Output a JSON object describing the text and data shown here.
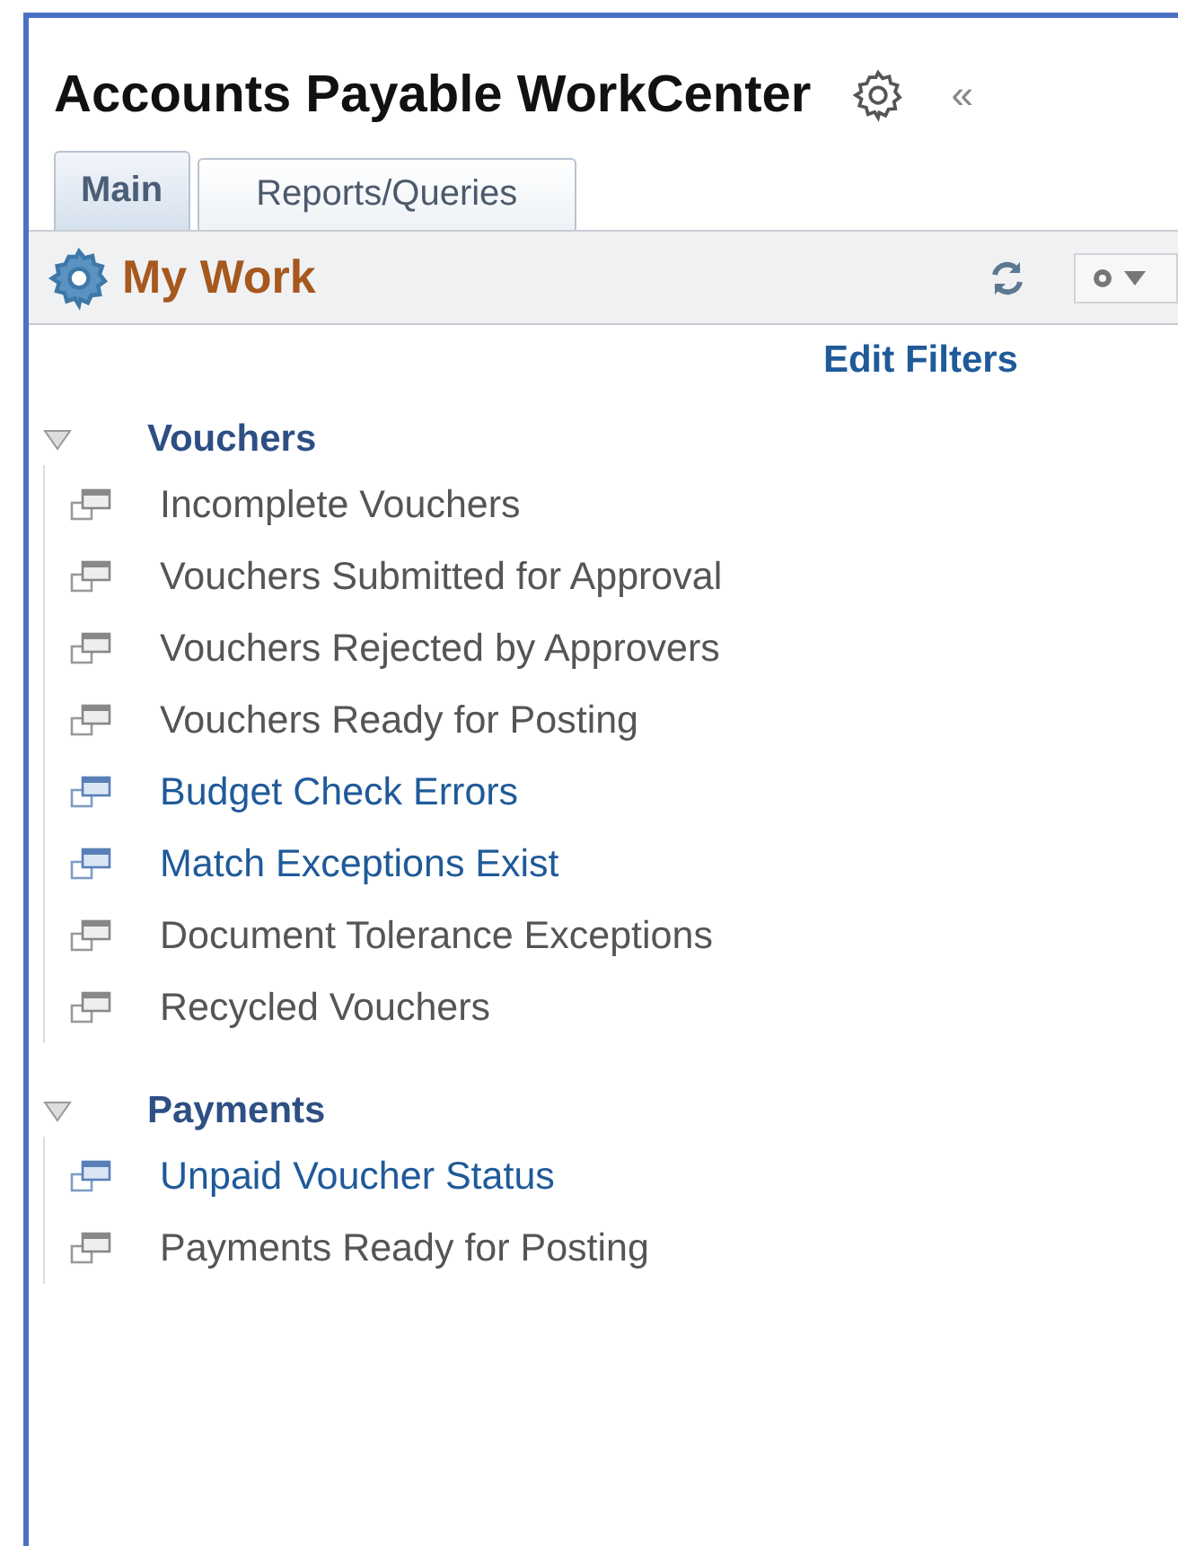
{
  "title": "Accounts Payable WorkCenter",
  "collapse": "«",
  "tabs": [
    {
      "label": "Main",
      "selected": true
    },
    {
      "label": "Reports/Queries",
      "selected": false
    }
  ],
  "pagelet": {
    "title": "My Work",
    "edit_filters": "Edit Filters"
  },
  "groups": [
    {
      "label": "Vouchers",
      "expanded": true,
      "items": [
        {
          "label": "Incomplete Vouchers",
          "active": false
        },
        {
          "label": "Vouchers Submitted for Approval",
          "active": false
        },
        {
          "label": "Vouchers Rejected by Approvers",
          "active": false
        },
        {
          "label": "Vouchers Ready for Posting",
          "active": false
        },
        {
          "label": "Budget Check Errors",
          "active": true
        },
        {
          "label": "Match Exceptions Exist",
          "active": true
        },
        {
          "label": "Document Tolerance Exceptions",
          "active": false
        },
        {
          "label": "Recycled Vouchers",
          "active": false
        }
      ]
    },
    {
      "label": "Payments",
      "expanded": true,
      "items": [
        {
          "label": "Unpaid Voucher Status",
          "active": true
        },
        {
          "label": "Payments Ready for Posting",
          "active": false
        }
      ]
    }
  ]
}
